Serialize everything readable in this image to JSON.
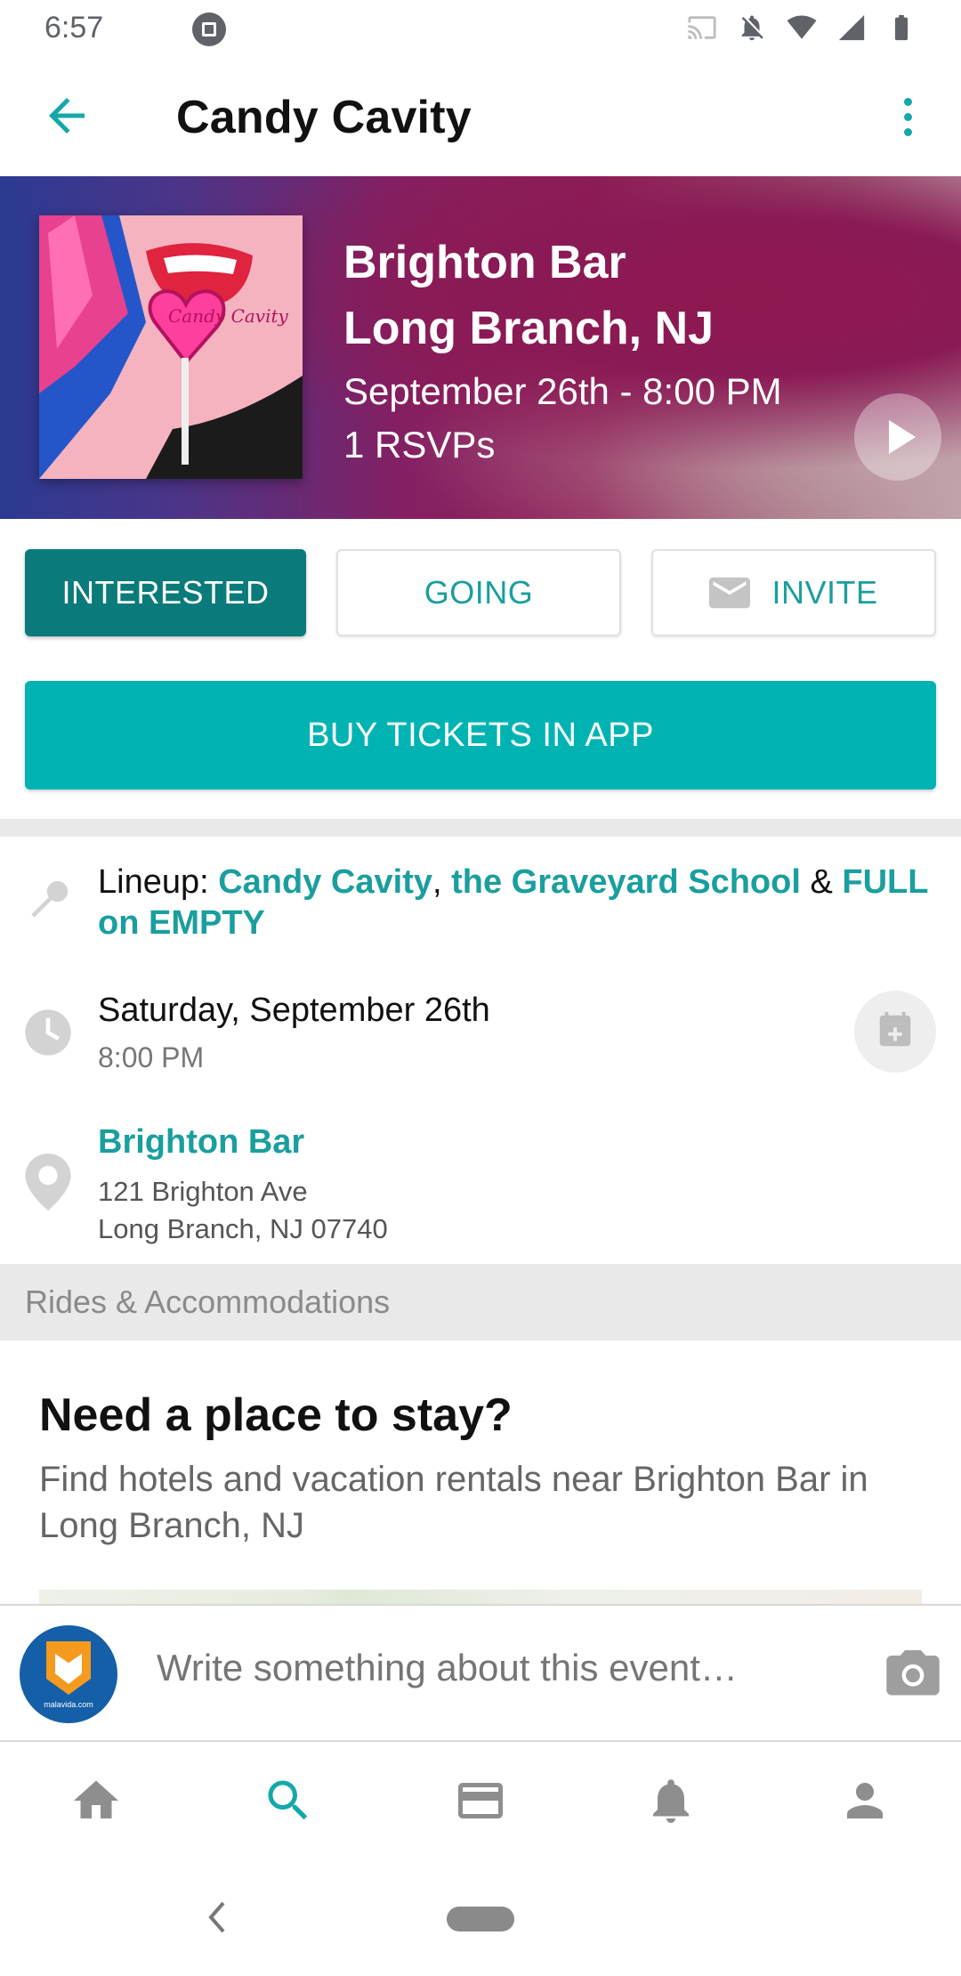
{
  "status_bar": {
    "time": "6:57"
  },
  "app_bar": {
    "title": "Candy Cavity"
  },
  "hero": {
    "venue_line": "Brighton Bar",
    "city_line": "Long Branch, NJ",
    "datetime": "September 26th - 8:00 PM",
    "rsvps": "1 RSVPs",
    "album_text": "Candy Cavity"
  },
  "actions": {
    "interested": "INTERESTED",
    "going": "GOING",
    "invite": "INVITE",
    "buy_tickets": "BUY TICKETS IN APP"
  },
  "lineup": {
    "prefix": "Lineup: ",
    "band1": "Candy Cavity",
    "sep1": ", ",
    "band2": "the Graveyard School",
    "sep2": " & ",
    "band3": "FULL on EMPTY"
  },
  "date": {
    "day": "Saturday, September 26th",
    "time": "8:00 PM"
  },
  "venue": {
    "name": "Brighton Bar",
    "address1": "121 Brighton Ave",
    "address2": "Long Branch, NJ 07740"
  },
  "rides": {
    "header": "Rides & Accommodations"
  },
  "stay": {
    "title": "Need a place to stay?",
    "description": "Find hotels and vacation rentals near Brighton Bar in Long Branch, NJ"
  },
  "composer": {
    "placeholder": "Write something about this event…",
    "avatar_label": "malavida.com"
  },
  "colors": {
    "accent": "#1a9e9e",
    "interested_bg": "#0b7a7a",
    "buy_bg": "#00b3b3"
  }
}
